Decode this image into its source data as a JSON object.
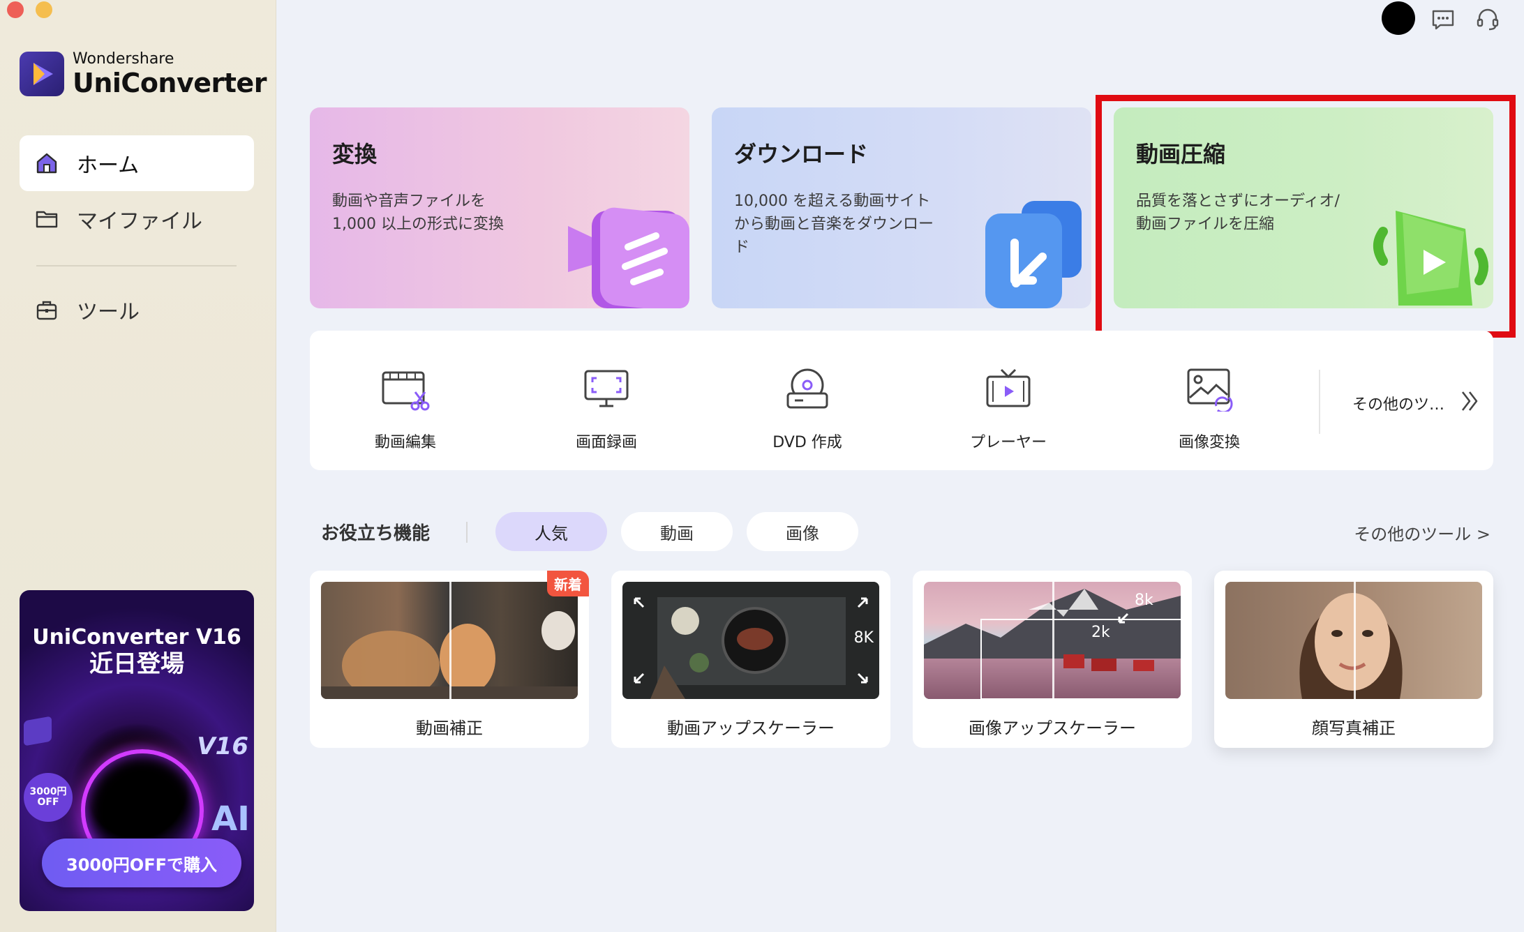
{
  "window": {
    "controls": [
      "close",
      "minimize"
    ]
  },
  "brand": {
    "company": "Wondershare",
    "product": "UniConverter"
  },
  "sidebar": {
    "items": [
      {
        "label": "ホーム",
        "icon": "home-icon",
        "active": true
      },
      {
        "label": "マイファイル",
        "icon": "folder-icon",
        "active": false
      },
      {
        "label": "ツール",
        "icon": "toolbox-icon",
        "active": false
      }
    ],
    "promo": {
      "title_line1": "UniConverter V16",
      "title_line2": "近日登場",
      "version_badge": "V16",
      "ai_badge": "AI",
      "discount_badge": "3000円\nOFF",
      "button": "3000円OFFで購入"
    }
  },
  "topbar": {
    "icons": [
      "avatar",
      "feedback-icon",
      "support-headset-icon"
    ]
  },
  "feature_cards": [
    {
      "title": "変換",
      "desc": "動画や音声ファイルを\n1,000 以上の形式に変換",
      "color": "#e9bfe6"
    },
    {
      "title": "ダウンロード",
      "desc": "10,000 を超える動画サイトから動画と音楽をダウンロード",
      "color": "#cad8f6"
    },
    {
      "title": "動画圧縮",
      "desc": "品質を落とさずにオーディオ/動画ファイルを圧縮",
      "color": "#c6ecc0",
      "highlighted": true
    }
  ],
  "highlight_color": "#e00b12",
  "tools": {
    "items": [
      {
        "label": "動画編集",
        "icon": "video-edit-icon"
      },
      {
        "label": "画面録画",
        "icon": "screen-record-icon"
      },
      {
        "label": "DVD 作成",
        "icon": "dvd-burn-icon"
      },
      {
        "label": "プレーヤー",
        "icon": "player-tv-icon"
      },
      {
        "label": "画像変換",
        "icon": "image-convert-icon"
      }
    ],
    "more": "その他のツ…"
  },
  "useful": {
    "title": "お役立ち機能",
    "tabs": [
      {
        "label": "人気",
        "active": true
      },
      {
        "label": "動画",
        "active": false
      },
      {
        "label": "画像",
        "active": false
      }
    ],
    "more_link": "その他のツール >",
    "cards": [
      {
        "label": "動画補正",
        "badge": "新着"
      },
      {
        "label": "動画アップスケーラー",
        "tag": "8K"
      },
      {
        "label": "画像アップスケーラー",
        "tag_a": "2k",
        "tag_b": "8k"
      },
      {
        "label": "顔写真補正"
      }
    ]
  },
  "accent": "#6f5cf2"
}
